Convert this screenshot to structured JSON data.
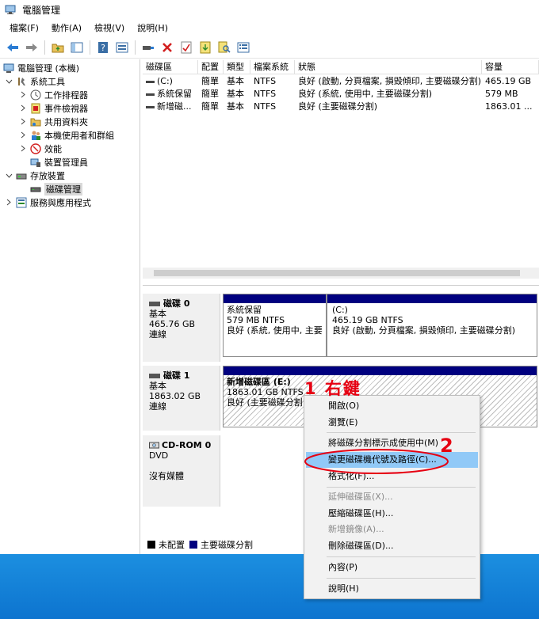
{
  "window": {
    "title": "電腦管理"
  },
  "menu": [
    "檔案(F)",
    "動作(A)",
    "檢視(V)",
    "說明(H)"
  ],
  "toolbar": {
    "icons": [
      "back-arrow-icon",
      "forward-arrow-icon",
      "folder-up-icon",
      "show-hide-tree-icon",
      "help-icon",
      "properties-icon",
      "connect-icon",
      "delete-icon",
      "check-icon",
      "import-icon",
      "search-icon",
      "list-icon"
    ]
  },
  "tree": {
    "root": "電腦管理 (本機)",
    "system_tools": "系統工具",
    "task_scheduler": "工作排程器",
    "event_viewer": "事件檢視器",
    "shared_folders": "共用資料夾",
    "local_users": "本機使用者和群組",
    "performance": "效能",
    "device_manager": "裝置管理員",
    "storage": "存放裝置",
    "disk_management": "磁碟管理",
    "services_apps": "服務與應用程式"
  },
  "volumes": {
    "headers": [
      "磁碟區",
      "配置",
      "類型",
      "檔案系統",
      "狀態",
      "容量"
    ],
    "rows": [
      [
        "(C:)",
        "簡單",
        "基本",
        "NTFS",
        "良好 (啟動, 分頁檔案, 損毀傾印, 主要磁碟分割)",
        "465.19 GB"
      ],
      [
        "系統保留",
        "簡單",
        "基本",
        "NTFS",
        "良好 (系統, 使用中, 主要磁碟分割)",
        "579 MB"
      ],
      [
        "新增磁...",
        "簡單",
        "基本",
        "NTFS",
        "良好 (主要磁碟分割)",
        "1863.01 ..."
      ]
    ]
  },
  "disks": {
    "disk0": {
      "name": "磁碟 0",
      "type": "基本",
      "size": "465.76 GB",
      "status": "連線",
      "p1": {
        "name": "系統保留",
        "size": "579 MB NTFS",
        "status": "良好 (系統, 使用中, 主要"
      },
      "p2": {
        "name": "(C:)",
        "size": "465.19 GB NTFS",
        "status": "良好 (啟動, 分頁檔案, 損毀傾印, 主要磁碟分割)"
      }
    },
    "disk1": {
      "name": "磁碟 1",
      "type": "基本",
      "size": "1863.02 GB",
      "status": "連線",
      "p1": {
        "name": "新增磁碟區 (E:)",
        "size": "1863.01 GB NTFS",
        "status": "良好 (主要磁碟分割"
      }
    },
    "cdrom0": {
      "name": "CD-ROM 0",
      "type": "DVD",
      "status": "沒有媒體"
    }
  },
  "legend": {
    "unallocated": "未配置",
    "primary": "主要磁碟分割"
  },
  "context_menu": {
    "open": "開啟(O)",
    "explore": "瀏覽(E)",
    "mark_active": "將磁碟分割標示成使用中(M)",
    "change_letter": "變更磁碟機代號及路徑(C)...",
    "format": "格式化(F)...",
    "extend": "延伸磁碟區(X)...",
    "shrink": "壓縮磁碟區(H)...",
    "add_mirror": "新增鏡像(A)...",
    "delete": "刪除磁碟區(D)...",
    "properties": "內容(P)",
    "help": "說明(H)"
  },
  "annotations": {
    "step1": "1 右鍵",
    "step2": "2"
  },
  "colors": {
    "primary_partition": "#00007f",
    "highlight": "#91c9f7",
    "annotation": "#e60012",
    "taskbar": "#0d74cf"
  }
}
